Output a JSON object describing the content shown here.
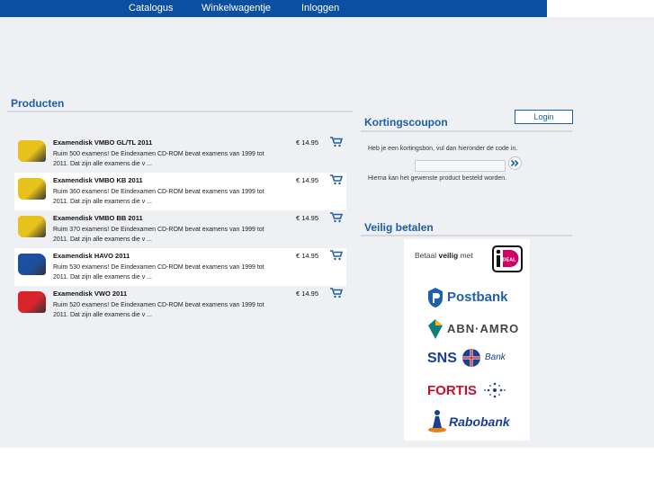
{
  "nav": {
    "items": [
      {
        "label": "Catalogus"
      },
      {
        "label": "Winkelwagentje"
      },
      {
        "label": "Inloggen"
      }
    ]
  },
  "products": {
    "title": "Producten",
    "items": [
      {
        "title": "Examendisk VMBO GL/TL 2011",
        "description": "Ruim 500 examens! De Eindexamen CD-ROM bevat examens van 1999 tot 2011. Dat zijn alle examens die v ...",
        "price": "€ 14.95",
        "image_color": "#e8c21c"
      },
      {
        "title": "Examendisk VMBO KB 2011",
        "description": "Ruim 360 examens! De Eindexamen CD-ROM bevat examens van 1999 tot 2011. Dat zijn alle examens die v ...",
        "price": "€ 14.95",
        "image_color": "#e8c21c"
      },
      {
        "title": "Examendisk VMBO BB 2011",
        "description": "Ruim 370 examens! De Eindexamen CD-ROM bevat examens van 1999 tot 2011. Dat zijn alle examens die v ...",
        "price": "€ 14.95",
        "image_color": "#e8c21c"
      },
      {
        "title": "Examendisk HAVO 2011",
        "description": "Ruim 530 examens! De Eindexamen CD-ROM bevat examens van 1999 tot 2011. Dat zijn alle examens die v ...",
        "price": "€ 14.95",
        "image_color": "#1d4fa0"
      },
      {
        "title": "Examendisk VWO 2011",
        "description": "Ruim 520 examens! De Eindexamen CD-ROM bevat examens van 1999 tot 2011. Dat zijn alle examens die v ...",
        "price": "€ 14.95",
        "image_color": "#d8242a"
      }
    ]
  },
  "login": {
    "label": "Login"
  },
  "coupon": {
    "title": "Kortingscoupon",
    "instruction": "Heb je een kortingsbon, vul dan hieronder de code in.",
    "input_value": "",
    "note": "Hierna kan het gewenste product besteld worden."
  },
  "payment": {
    "title": "Veilig betalen",
    "ideal_prefix": "Betaal",
    "ideal_bold": "veilig",
    "ideal_suffix": "met",
    "ideal_logo_text": "iDEAL",
    "banks": [
      {
        "label": "Postbank",
        "icon": "postbank-lion-icon"
      },
      {
        "label": "ABN·AMRO",
        "icon": "abn-amro-shield-icon"
      },
      {
        "label": "SNS",
        "suffix": "Bank",
        "icon": "sns-ball-icon"
      },
      {
        "label": "FORTIS",
        "icon": "fortis-star-icon"
      },
      {
        "label": "Rabobank",
        "icon": "rabobank-figure-icon"
      }
    ]
  },
  "colors": {
    "nav_bar": "#0b4fa0",
    "accent": "#1d5ea8",
    "background": "#eef0f4"
  }
}
